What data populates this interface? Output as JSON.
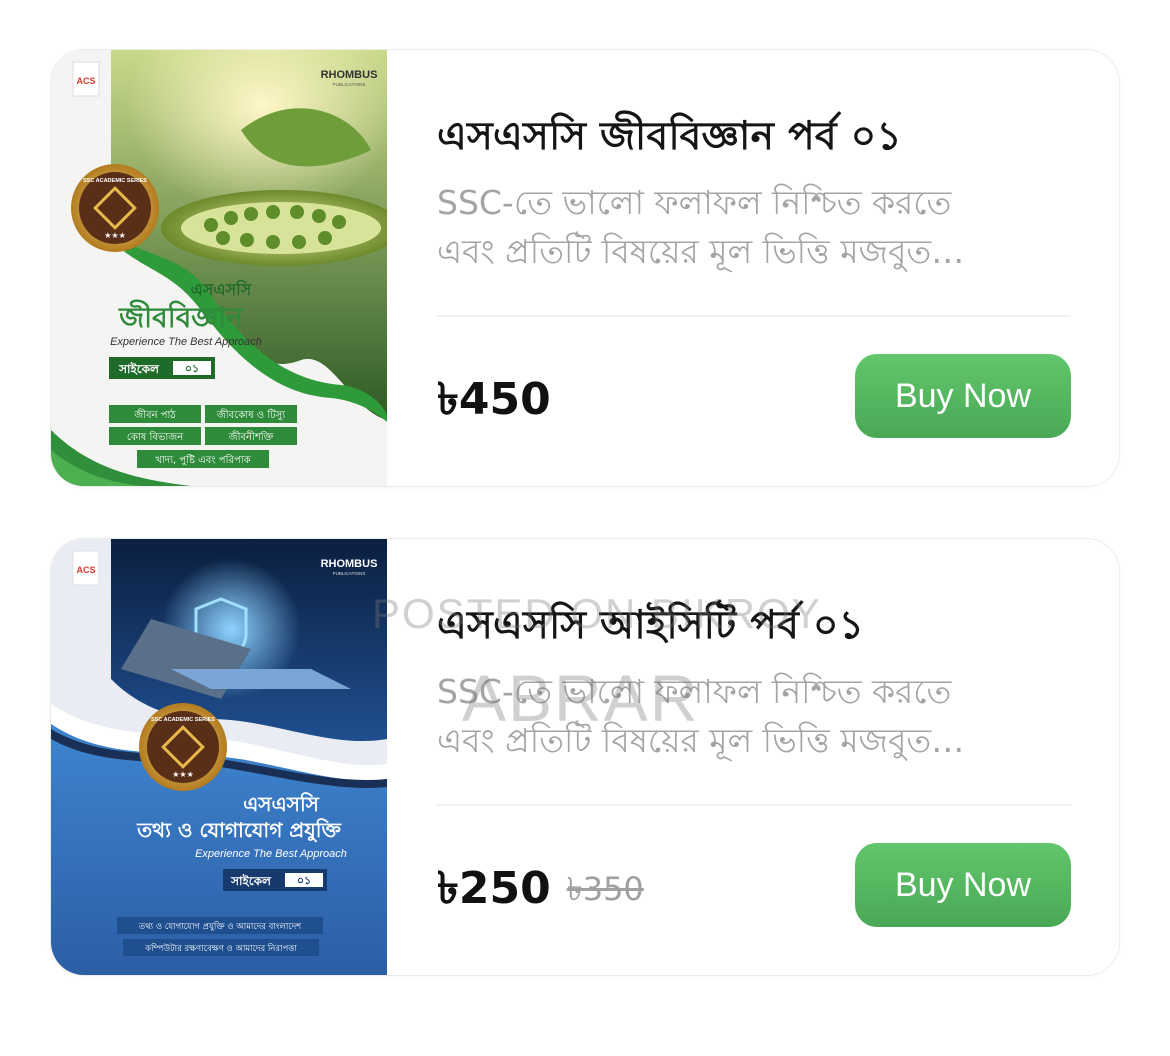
{
  "products": [
    {
      "title": "এসএসসি জীববিজ্ঞান পর্ব ০১",
      "description_line1": "SSC-তে ভালো ফলাফল নিশ্চিত করতে",
      "description_line2": "এবং প্রতিটি বিষয়ের মূল ভিত্তি মজবুত…",
      "price": "৳450",
      "buy_label": "Buy Now",
      "cover": {
        "publisher": "RHOMBUS",
        "publisher_sub": "PUBLICATIONS",
        "logo": "ACS",
        "badge": "SSC ACADEMIC SERIES",
        "subject_small": "এসএসসি",
        "subject": "জীববিজ্ঞান",
        "tagline": "Experience The Best Approach",
        "cycle_label": "সাইকেল",
        "cycle_no": "০১",
        "topics": [
          "জীবন পাঠ",
          "জীবকোষ ও টিস্যু",
          "কোষ বিভাজন",
          "জীবনীশক্তি",
          "খাদ্য, পুষ্টি এবং পরিপাক"
        ]
      }
    },
    {
      "title": "এসএসসি আইসিটি পর্ব ০১",
      "description_line1": "SSC-তে ভালো ফলাফল নিশ্চিত করতে",
      "description_line2": "এবং প্রতিটি বিষয়ের মূল ভিত্তি মজবুত…",
      "price": "৳250",
      "old_price": "৳350",
      "buy_label": "Buy Now",
      "cover": {
        "publisher": "RHOMBUS",
        "publisher_sub": "PUBLICATIONS",
        "logo": "ACS",
        "badge": "SSC ACADEMIC SERIES",
        "subject_small": "এসএসসি",
        "subject": "তথ্য ও যোগাযোগ প্রযুক্তি",
        "tagline": "Experience The Best Approach",
        "cycle_label": "সাইকেল",
        "cycle_no": "০১",
        "topics": [
          "তথ্য ও যোগাযোগ প্রযুক্তি ও আমাদের বাংলাদেশ",
          "কম্পিউটার রক্ষণাবেক্ষণ ও আমাদের নিরাপত্তা"
        ]
      }
    }
  ],
  "watermark": {
    "line1": "POSTED ON BIKROY",
    "line2": "ABRAR"
  },
  "colors": {
    "buy_button": "#55b862",
    "bio_green": "#2f8f3a",
    "ict_blue": "#2f6cb3"
  }
}
